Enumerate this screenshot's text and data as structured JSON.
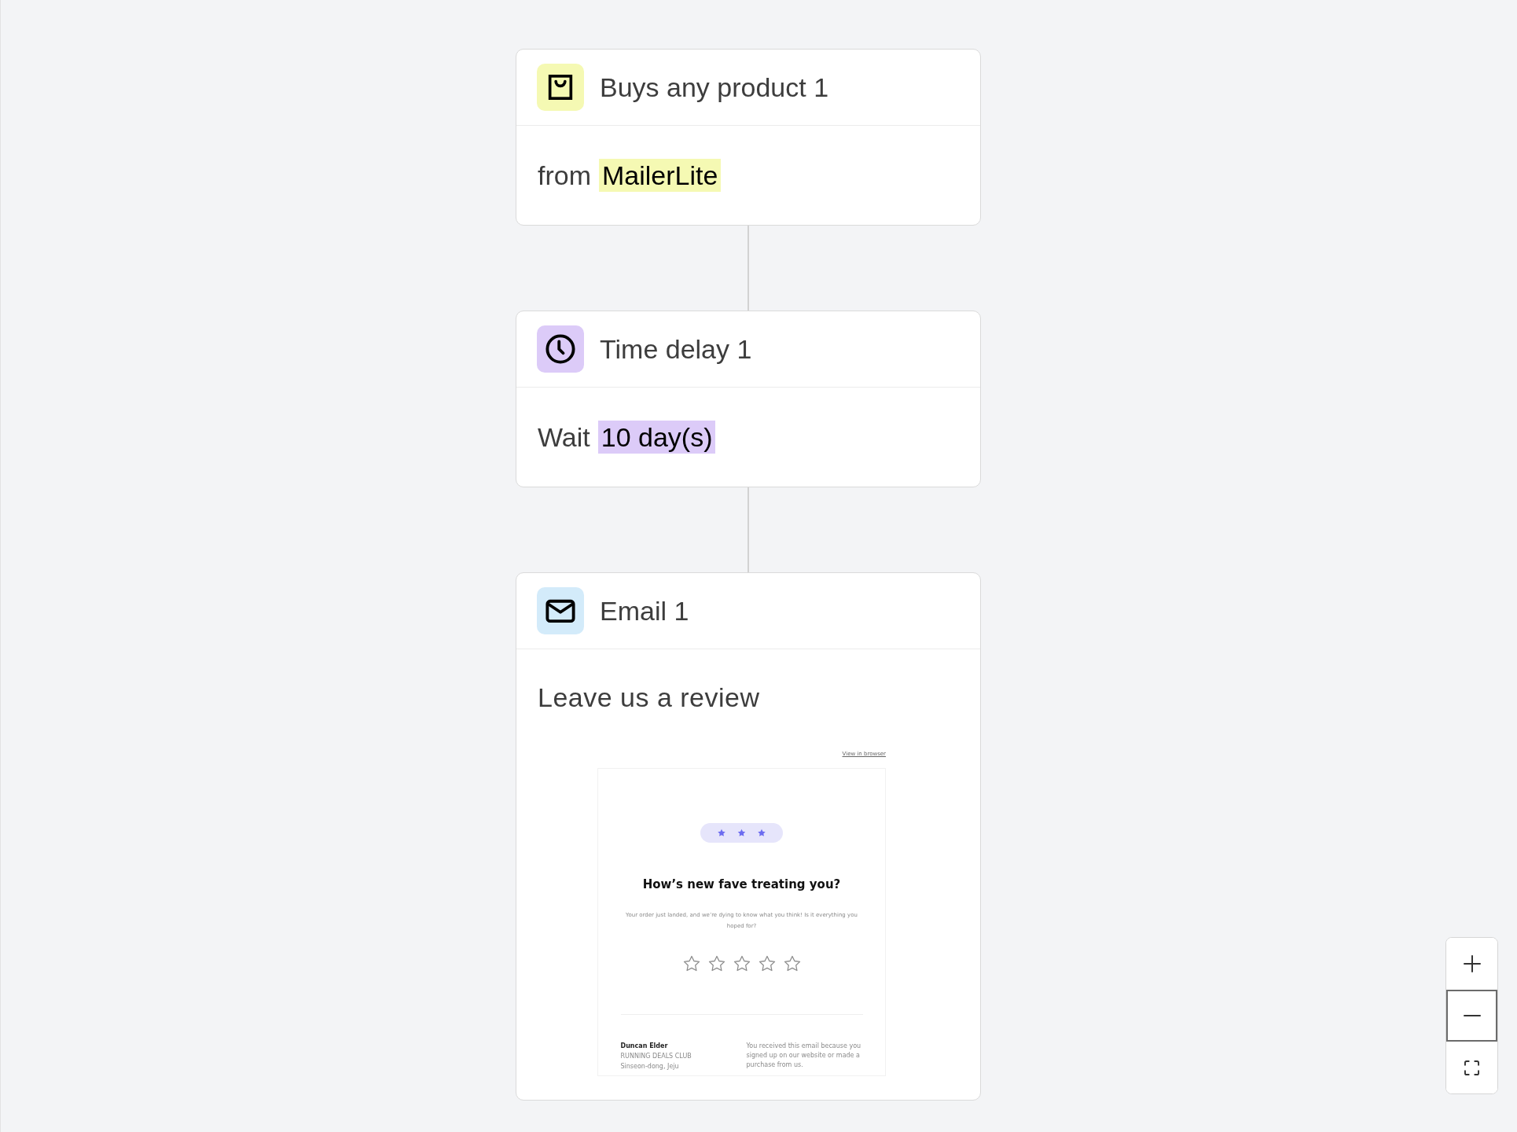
{
  "flow": {
    "nodes": [
      {
        "kind": "trigger",
        "title": "Buys any product 1",
        "color": "#f5f9b3",
        "prefix": "from",
        "value": "MailerLite"
      },
      {
        "kind": "delay",
        "title": "Time delay 1",
        "color": "#dccbf8",
        "prefix": "Wait",
        "value": "10 day(s)"
      },
      {
        "kind": "email",
        "title": "Email 1",
        "color": "#d3ebfa",
        "subject": "Leave us a review",
        "preview": {
          "view_link": "View in browser",
          "heading": "How’s new fave treating you?",
          "text": "Your order just landed, and we’re dying to know what you think! Is it everything you hoped for?",
          "stars": 0,
          "sender_name": "Duncan Elder",
          "sender_company": "RUNNING DEALS CLUB",
          "sender_address": "Sinseon-dong, Jeju",
          "notice": "You received this email because you signed up on our website or made a purchase from us."
        }
      }
    ]
  },
  "zoom_controls": [
    {
      "kind": "zoom_in",
      "focused": false
    },
    {
      "kind": "zoom_out",
      "focused": true
    },
    {
      "kind": "fit_view",
      "focused": false
    }
  ]
}
